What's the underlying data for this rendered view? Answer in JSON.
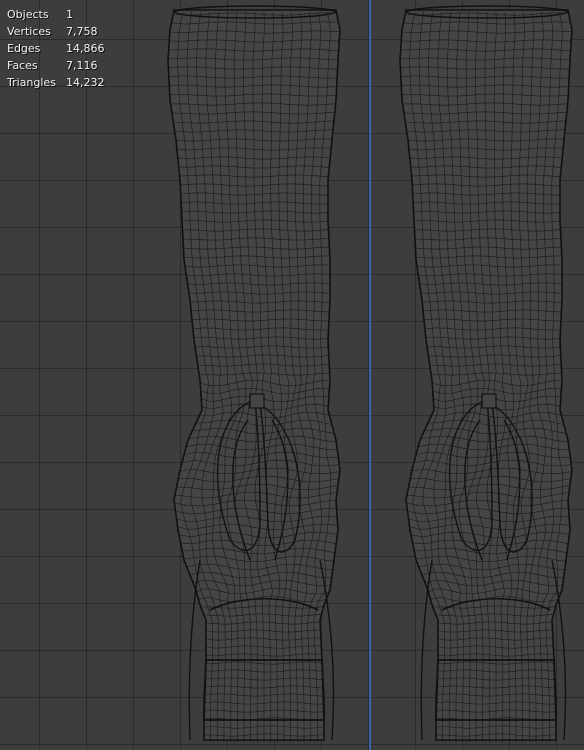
{
  "viewport": {
    "background_color": "#3d3d3d",
    "grid_color": "#2f2f2f",
    "axis_color": "#3a64a8",
    "mesh_color": "#111111",
    "mesh_fill": "#454545"
  },
  "stats": {
    "objects_label": "Objects",
    "objects_value": "1",
    "vertices_label": "Vertices",
    "vertices_value": "7,758",
    "edges_label": "Edges",
    "edges_value": "14,866",
    "faces_label": "Faces",
    "faces_value": "7,116",
    "triangles_label": "Triangles",
    "triangles_value": "14,232"
  }
}
